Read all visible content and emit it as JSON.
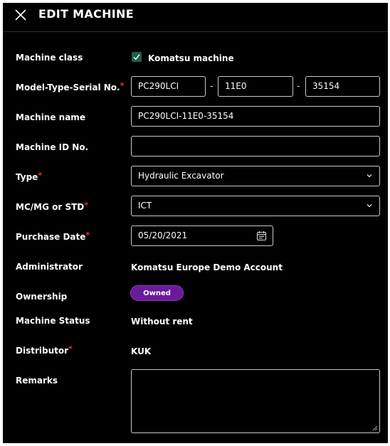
{
  "header": {
    "title": "EDIT MACHINE"
  },
  "fields": {
    "machine_class": {
      "label": "Machine class",
      "checkbox_label": "Komatsu machine",
      "checked": true
    },
    "model_type_serial": {
      "label": "Model-Type-Serial No.",
      "model": "PC290LCI",
      "type": "11E0",
      "serial": "35154",
      "separator": "-"
    },
    "machine_name": {
      "label": "Machine name",
      "value": "PC290LCI-11E0-35154"
    },
    "machine_id": {
      "label": "Machine ID No.",
      "value": ""
    },
    "type": {
      "label": "Type",
      "value": "Hydraulic Excavator"
    },
    "mc_mg_std": {
      "label": "MC/MG or STD",
      "value": "ICT"
    },
    "purchase_date": {
      "label": "Purchase Date",
      "value": "05/20/2021"
    },
    "administrator": {
      "label": "Administrator",
      "value": "Komatsu Europe Demo Account"
    },
    "ownership": {
      "label": "Ownership",
      "value": "Owned"
    },
    "machine_status": {
      "label": "Machine Status",
      "value": "Without rent"
    },
    "distributor": {
      "label": "Distributor",
      "value": "KUK"
    },
    "remarks": {
      "label": "Remarks",
      "value": ""
    }
  },
  "required_marker": "*",
  "colors": {
    "background": "#000000",
    "accent_purple": "#6a1b9a",
    "checkbox_green": "#1f5f4a",
    "required_red": "#e53935"
  },
  "icons": {
    "close": "close-icon",
    "chevron": "chevron-down-icon",
    "calendar": "calendar-icon",
    "check": "check-icon"
  }
}
